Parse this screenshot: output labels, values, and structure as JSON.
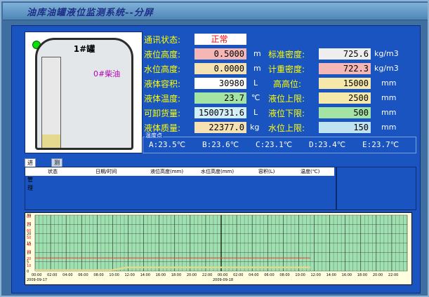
{
  "window": {
    "title": "油库油罐液位监测系统--分屏"
  },
  "tank": {
    "name": "1#罐",
    "oil_type": "0#柴油",
    "level_fraction": 0.17
  },
  "status": {
    "label": "通讯状态:",
    "value": "正常"
  },
  "readings": {
    "level_height": {
      "label": "液位高度:",
      "value": "0.5000",
      "unit": "m"
    },
    "water_height": {
      "label": "水位高度:",
      "value": "0.0000",
      "unit": "m"
    },
    "volume": {
      "label": "液体容积:",
      "value": "30980",
      "unit": "L"
    },
    "temperature": {
      "label": "液体温度:",
      "value": "23.7",
      "unit": "℃"
    },
    "unload_volume": {
      "label": "可卸货量:",
      "value": "1500731.6",
      "unit": "L"
    },
    "mass": {
      "label": "液体质量:",
      "value": "22377.0",
      "unit": "kg"
    },
    "std_density": {
      "label": "标准密度:",
      "value": "725.6",
      "unit": "kg/m3"
    },
    "meas_density": {
      "label": "计重密度:",
      "value": "722.3",
      "unit": "kg/m3"
    },
    "high_high": {
      "label": "高高位:",
      "value": "15000",
      "unit": "mm"
    },
    "upper_limit": {
      "label": "液位上限:",
      "value": "2500",
      "unit": "mm"
    },
    "lower_limit": {
      "label": "液位下限:",
      "value": "500",
      "unit": "mm"
    },
    "water_upper": {
      "label": "水位上限:",
      "value": "150",
      "unit": "mm"
    }
  },
  "temps": {
    "title": "温度点",
    "points": [
      "A:23.5℃",
      "B:23.6℃",
      "C:23.1℃",
      "D:23.4℃",
      "E:23.7℃"
    ]
  },
  "tabs": [
    "进油管理",
    "测漏"
  ],
  "list": {
    "columns": [
      "状态",
      "日期/时间",
      "液位高度(mm)",
      "水位高度(mm)",
      "容积(L)",
      "温度(℃)"
    ]
  },
  "colors": {
    "ok": "#00e100",
    "status_text": "#ff0000",
    "label": "#ffff00"
  },
  "chart_data": {
    "type": "line",
    "y_ticks": [
      "30",
      "25",
      "20",
      "15",
      "10",
      "5",
      "0"
    ],
    "left_markers": [
      "80",
      "70",
      "60",
      "50",
      "40",
      "30",
      "20",
      "10"
    ],
    "x_ticks": [
      "00:00",
      "02:00",
      "04:00",
      "06:00",
      "08:00",
      "10:00",
      "12:00",
      "14:00",
      "16:00",
      "18:00",
      "20:00",
      "22:00",
      "00:00",
      "02:00",
      "04:00",
      "06:00",
      "08:00",
      "10:00",
      "12:00",
      "14:00",
      "16:00",
      "18:00",
      "20:00",
      "22:00"
    ],
    "dates": [
      "2009-09-17",
      "2009-09-18"
    ],
    "ylim": [
      0,
      30
    ],
    "series": [
      {
        "color": "#ff3333",
        "values": [
          7,
          7,
          7,
          7,
          7,
          7,
          7,
          7,
          7,
          7,
          7,
          7,
          7,
          7,
          7,
          7,
          7,
          7,
          7
        ]
      },
      {
        "color": "#e4d98e",
        "values": [
          0.5,
          0.5,
          0.5,
          0.5,
          0.5,
          0.5,
          2,
          2,
          2,
          2,
          2,
          2,
          2,
          2,
          2,
          2,
          2,
          2,
          2
        ]
      }
    ]
  }
}
